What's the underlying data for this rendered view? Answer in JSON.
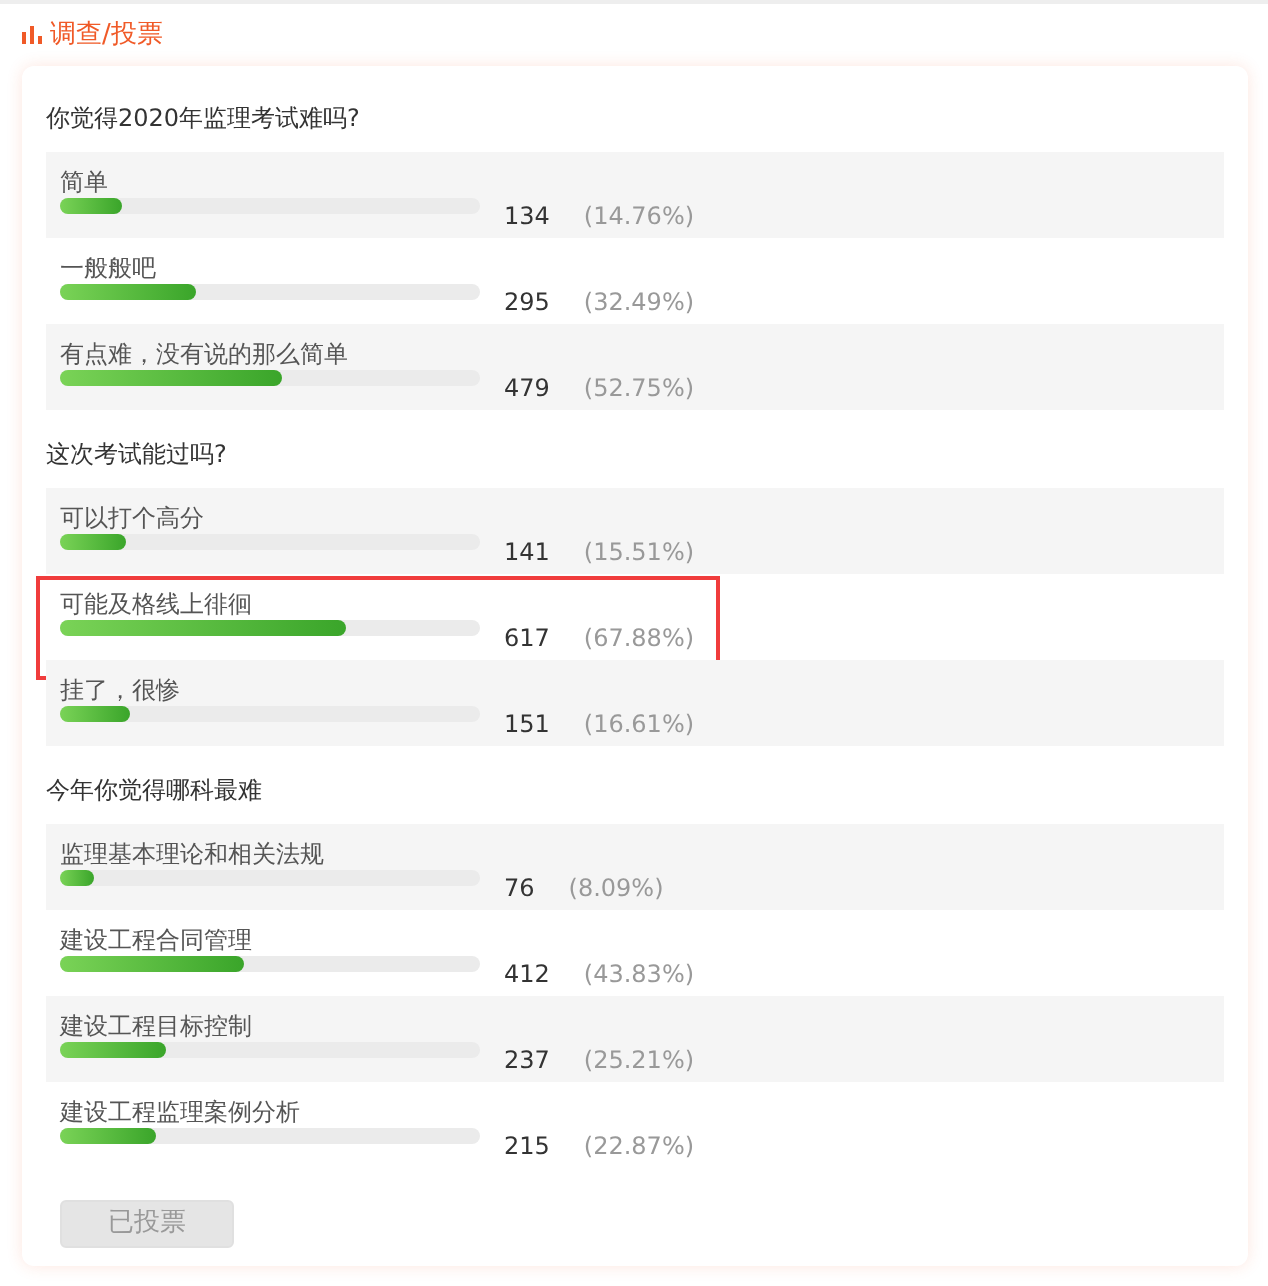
{
  "header": {
    "title": "调查/投票"
  },
  "questions": [
    {
      "title": "你觉得2020年监理考试难吗?",
      "options": [
        {
          "label": "简单",
          "level": 0.1476,
          "count": "134",
          "percent": "(14.76%)",
          "highlighted": false
        },
        {
          "label": "一般般吧",
          "level": 0.3249,
          "count": "295",
          "percent": "(32.49%)",
          "highlighted": false
        },
        {
          "label": "有点难，没有说的那么简单",
          "level": 0.5275,
          "count": "479",
          "percent": "(52.75%)",
          "highlighted": false
        }
      ]
    },
    {
      "title": "这次考试能过吗?",
      "options": [
        {
          "label": "可以打个高分",
          "level": 0.1551,
          "count": "141",
          "percent": "(15.51%)",
          "highlighted": false
        },
        {
          "label": "可能及格线上徘徊",
          "level": 0.6788,
          "count": "617",
          "percent": "(67.88%)",
          "highlighted": true
        },
        {
          "label": "挂了，很惨",
          "level": 0.1661,
          "count": "151",
          "percent": "(16.61%)",
          "highlighted": false
        }
      ]
    },
    {
      "title": "今年你觉得哪科最难",
      "options": [
        {
          "label": "监理基本理论和相关法规",
          "level": 0.0809,
          "count": "76",
          "percent": "(8.09%)",
          "highlighted": false
        },
        {
          "label": "建设工程合同管理",
          "level": 0.4383,
          "count": "412",
          "percent": "(43.83%)",
          "highlighted": false
        },
        {
          "label": "建设工程目标控制",
          "level": 0.2521,
          "count": "237",
          "percent": "(25.21%)",
          "highlighted": false
        },
        {
          "label": "建设工程监理案例分析",
          "level": 0.2287,
          "count": "215",
          "percent": "(22.87%)",
          "highlighted": false
        }
      ]
    }
  ],
  "submit": {
    "label": "已投票",
    "disabled": true
  }
}
